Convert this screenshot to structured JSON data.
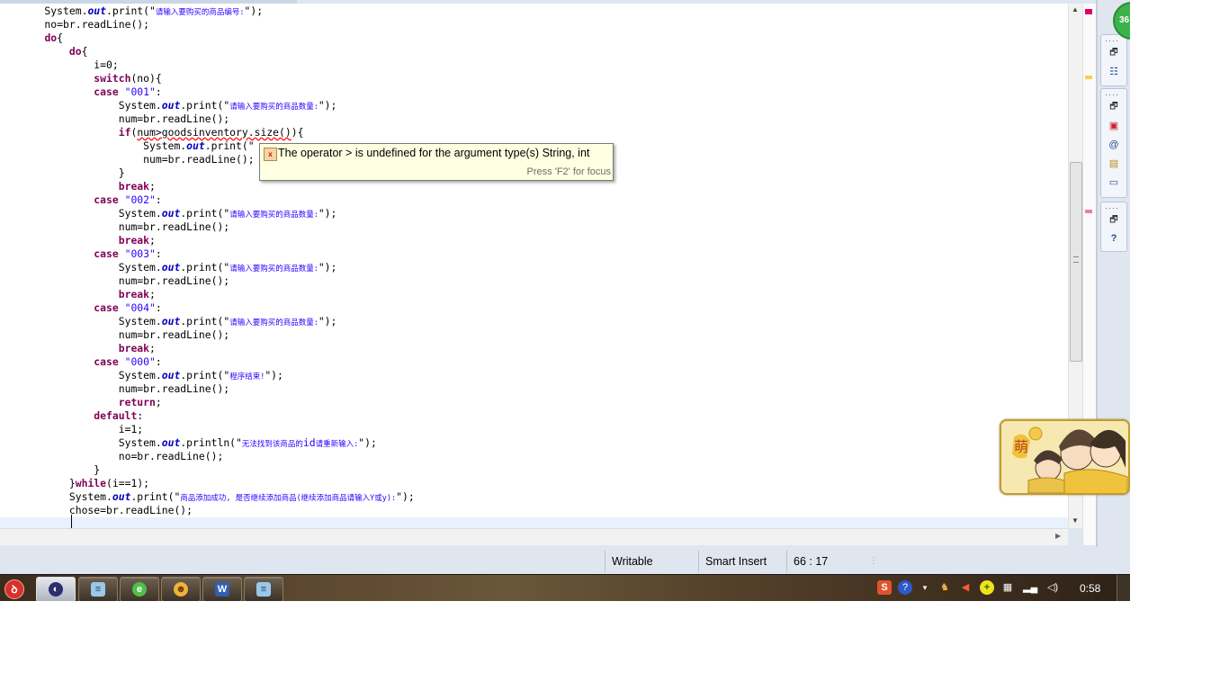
{
  "code_lines": [
    [
      {
        "t": "    System.",
        "c": ""
      },
      {
        "t": "out",
        "c": "fld"
      },
      {
        "t": ".print(\"",
        "c": ""
      },
      {
        "t": "请输入要购买的商品编号:",
        "c": "st zh"
      },
      {
        "t": "\");",
        "c": ""
      }
    ],
    [
      {
        "t": "    no=br.readLine();",
        "c": ""
      }
    ],
    [
      {
        "t": "    ",
        "c": ""
      },
      {
        "t": "do",
        "c": "kw"
      },
      {
        "t": "{",
        "c": ""
      }
    ],
    [
      {
        "t": "        ",
        "c": ""
      },
      {
        "t": "do",
        "c": "kw"
      },
      {
        "t": "{",
        "c": ""
      }
    ],
    [
      {
        "t": "            i=0;",
        "c": ""
      }
    ],
    [
      {
        "t": "            ",
        "c": ""
      },
      {
        "t": "switch",
        "c": "kw"
      },
      {
        "t": "(no){",
        "c": ""
      }
    ],
    [
      {
        "t": "            ",
        "c": ""
      },
      {
        "t": "case",
        "c": "kw"
      },
      {
        "t": " ",
        "c": ""
      },
      {
        "t": "\"001\"",
        "c": "st"
      },
      {
        "t": ":",
        "c": ""
      }
    ],
    [
      {
        "t": "                System.",
        "c": ""
      },
      {
        "t": "out",
        "c": "fld"
      },
      {
        "t": ".print(\"",
        "c": ""
      },
      {
        "t": "请输入要购买的商品数量:",
        "c": "st zh"
      },
      {
        "t": "\");",
        "c": ""
      }
    ],
    [
      {
        "t": "                num=br.readLine();",
        "c": ""
      }
    ],
    [
      {
        "t": "                ",
        "c": ""
      },
      {
        "t": "if",
        "c": "kw"
      },
      {
        "t": "(",
        "c": ""
      },
      {
        "t": "num>goodsinventory.size()",
        "c": "err"
      },
      {
        "t": "){",
        "c": ""
      }
    ],
    [
      {
        "t": "                    System.",
        "c": ""
      },
      {
        "t": "out",
        "c": "fld"
      },
      {
        "t": ".print(\"",
        "c": ""
      }
    ],
    [
      {
        "t": "                    num=br.readLine();",
        "c": ""
      }
    ],
    [
      {
        "t": "                }",
        "c": ""
      }
    ],
    [
      {
        "t": "                ",
        "c": ""
      },
      {
        "t": "break",
        "c": "kw"
      },
      {
        "t": ";",
        "c": ""
      }
    ],
    [
      {
        "t": "            ",
        "c": ""
      },
      {
        "t": "case",
        "c": "kw"
      },
      {
        "t": " ",
        "c": ""
      },
      {
        "t": "\"002\"",
        "c": "st"
      },
      {
        "t": ":",
        "c": ""
      }
    ],
    [
      {
        "t": "                System.",
        "c": ""
      },
      {
        "t": "out",
        "c": "fld"
      },
      {
        "t": ".print(\"",
        "c": ""
      },
      {
        "t": "请输入要购买的商品数量:",
        "c": "st zh"
      },
      {
        "t": "\");",
        "c": ""
      }
    ],
    [
      {
        "t": "                num=br.readLine();",
        "c": ""
      }
    ],
    [
      {
        "t": "                ",
        "c": ""
      },
      {
        "t": "break",
        "c": "kw"
      },
      {
        "t": ";",
        "c": ""
      }
    ],
    [
      {
        "t": "            ",
        "c": ""
      },
      {
        "t": "case",
        "c": "kw"
      },
      {
        "t": " ",
        "c": ""
      },
      {
        "t": "\"003\"",
        "c": "st"
      },
      {
        "t": ":",
        "c": ""
      }
    ],
    [
      {
        "t": "                System.",
        "c": ""
      },
      {
        "t": "out",
        "c": "fld"
      },
      {
        "t": ".print(\"",
        "c": ""
      },
      {
        "t": "请输入要购买的商品数量:",
        "c": "st zh"
      },
      {
        "t": "\");",
        "c": ""
      }
    ],
    [
      {
        "t": "                num=br.readLine();",
        "c": ""
      }
    ],
    [
      {
        "t": "                ",
        "c": ""
      },
      {
        "t": "break",
        "c": "kw"
      },
      {
        "t": ";",
        "c": ""
      }
    ],
    [
      {
        "t": "            ",
        "c": ""
      },
      {
        "t": "case",
        "c": "kw"
      },
      {
        "t": " ",
        "c": ""
      },
      {
        "t": "\"004\"",
        "c": "st"
      },
      {
        "t": ":",
        "c": ""
      }
    ],
    [
      {
        "t": "                System.",
        "c": ""
      },
      {
        "t": "out",
        "c": "fld"
      },
      {
        "t": ".print(\"",
        "c": ""
      },
      {
        "t": "请输入要购买的商品数量:",
        "c": "st zh"
      },
      {
        "t": "\");",
        "c": ""
      }
    ],
    [
      {
        "t": "                num=br.readLine();",
        "c": ""
      }
    ],
    [
      {
        "t": "                ",
        "c": ""
      },
      {
        "t": "break",
        "c": "kw"
      },
      {
        "t": ";",
        "c": ""
      }
    ],
    [
      {
        "t": "            ",
        "c": ""
      },
      {
        "t": "case",
        "c": "kw"
      },
      {
        "t": " ",
        "c": ""
      },
      {
        "t": "\"000\"",
        "c": "st"
      },
      {
        "t": ":",
        "c": ""
      }
    ],
    [
      {
        "t": "                System.",
        "c": ""
      },
      {
        "t": "out",
        "c": "fld"
      },
      {
        "t": ".print(\"",
        "c": ""
      },
      {
        "t": "程序结束!",
        "c": "st zh"
      },
      {
        "t": "\");",
        "c": ""
      }
    ],
    [
      {
        "t": "                num=br.readLine();",
        "c": ""
      }
    ],
    [
      {
        "t": "                ",
        "c": ""
      },
      {
        "t": "return",
        "c": "kw"
      },
      {
        "t": ";",
        "c": ""
      }
    ],
    [
      {
        "t": "            ",
        "c": ""
      },
      {
        "t": "default",
        "c": "kw"
      },
      {
        "t": ":",
        "c": ""
      }
    ],
    [
      {
        "t": "                i=1;",
        "c": ""
      }
    ],
    [
      {
        "t": "                System.",
        "c": ""
      },
      {
        "t": "out",
        "c": "fld"
      },
      {
        "t": ".println(\"",
        "c": ""
      },
      {
        "t": "无法找到该商品的",
        "c": "st zh"
      },
      {
        "t": "id",
        "c": "st"
      },
      {
        "t": "请重新输入:",
        "c": "st zh"
      },
      {
        "t": "\");",
        "c": ""
      }
    ],
    [
      {
        "t": "                no=br.readLine();",
        "c": ""
      }
    ],
    [
      {
        "t": "            }",
        "c": ""
      }
    ],
    [
      {
        "t": "        }",
        "c": ""
      },
      {
        "t": "while",
        "c": "kw"
      },
      {
        "t": "(i==1);",
        "c": ""
      }
    ],
    [
      {
        "t": "        System.",
        "c": ""
      },
      {
        "t": "out",
        "c": "fld"
      },
      {
        "t": ".print(\"",
        "c": ""
      },
      {
        "t": "商品添加成功, 是否继续添加商品(继续添加商品请输入Y或y):",
        "c": "st zh"
      },
      {
        "t": "\");",
        "c": ""
      }
    ],
    [
      {
        "t": "        chose=br.readLine();",
        "c": ""
      }
    ],
    [
      {
        "t": "",
        "c": ""
      }
    ]
  ],
  "tooltip": {
    "message": "The operator > is undefined for the argument type(s) String, int",
    "hint": "Press 'F2' for focus",
    "icon": "error-quickfix-icon"
  },
  "status_bar": {
    "mode": "Writable",
    "insert_mode": "Smart Insert",
    "position": "66 : 17"
  },
  "badge": {
    "label": "36"
  },
  "mascot": {
    "label": "萌"
  },
  "taskbar": {
    "clock": "0:58",
    "buttons": [
      "eclipse-icon",
      "notepad-icon",
      "browser-icon",
      "chat-icon",
      "word-icon",
      "notepad-icon"
    ],
    "tray": [
      "sogou-icon",
      "help-icon",
      "expand-icon",
      "bird-icon",
      "volume-mute-icon",
      "add-icon",
      "network-icon",
      "signal-icon",
      "speaker-icon"
    ]
  },
  "colors": {
    "keyword": "#7f0055",
    "string": "#2a00ff",
    "field": "#0000c0",
    "error": "#ff0000",
    "current_line": "#e8f2fe",
    "tooltip_bg": "#ffffe1"
  }
}
